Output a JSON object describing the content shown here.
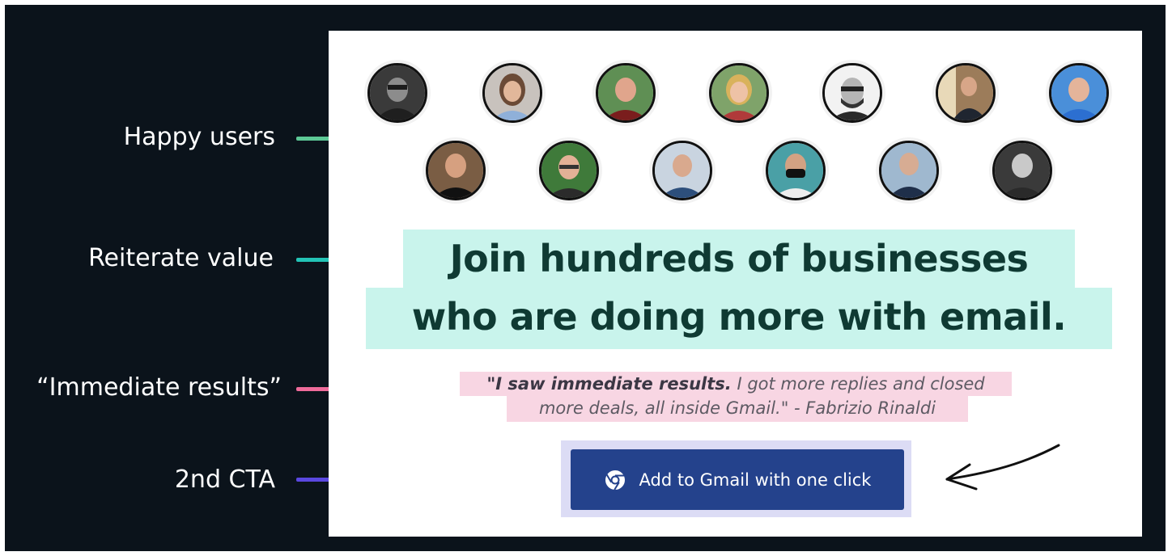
{
  "annotations": [
    {
      "label": "Happy users",
      "color": "#5dc896"
    },
    {
      "label": "Reiterate value",
      "color": "#23c3b6"
    },
    {
      "label": "“Immediate results”",
      "color": "#ef6b9a"
    },
    {
      "label": "2nd CTA",
      "color": "#5a48e0"
    }
  ],
  "avatars_row1": [
    "user-avatar-1",
    "user-avatar-2",
    "user-avatar-3",
    "user-avatar-4",
    "user-avatar-5",
    "user-avatar-6",
    "user-avatar-7"
  ],
  "avatars_row2": [
    "user-avatar-8",
    "user-avatar-9",
    "user-avatar-10",
    "user-avatar-11",
    "user-avatar-12",
    "user-avatar-13"
  ],
  "headline": {
    "line1": "Join hundreds of businesses",
    "line2": "who are doing more with email."
  },
  "quote": {
    "bold": "\"I saw immediate results.",
    "rest1": " I got more replies and closed",
    "line2": "more deals, all inside Gmail.\" - Fabrizio Rinaldi"
  },
  "cta": {
    "label": "Add to Gmail with one click",
    "icon": "chrome-icon"
  },
  "colors": {
    "background": "#0b131b",
    "headline_highlight": "#c9f4ec",
    "headline_text": "#0f3a33",
    "quote_highlight": "#f8d6e3",
    "cta_button": "#24428c",
    "cta_halo": "#dcdcf5"
  }
}
